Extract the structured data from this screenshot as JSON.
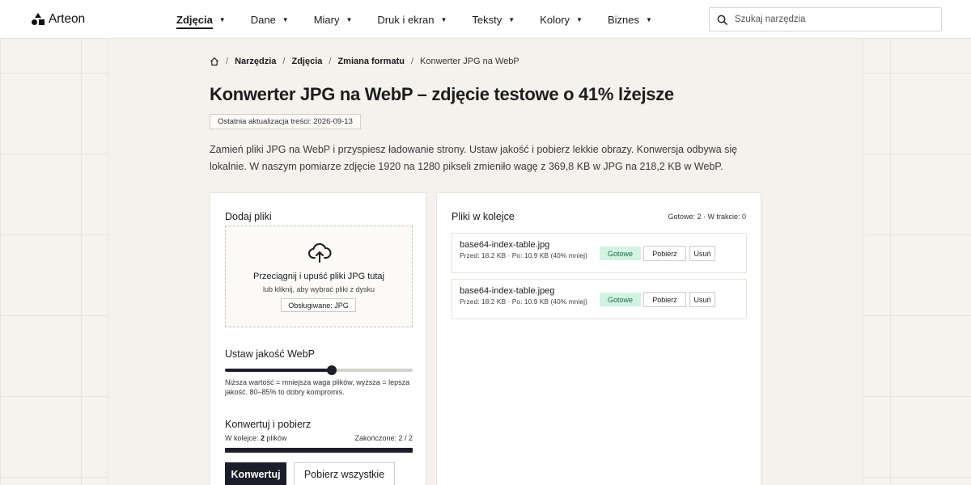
{
  "brand": {
    "name": "Arteon"
  },
  "nav": {
    "items": [
      {
        "label": "Zdjęcia",
        "active": true
      },
      {
        "label": "Dane",
        "active": false
      },
      {
        "label": "Miary",
        "active": false
      },
      {
        "label": "Druk i ekran",
        "active": false
      },
      {
        "label": "Teksty",
        "active": false
      },
      {
        "label": "Kolory",
        "active": false
      },
      {
        "label": "Biznes",
        "active": false
      }
    ]
  },
  "search": {
    "placeholder": "Szukaj narzędzia"
  },
  "breadcrumb": {
    "items": [
      "Narzędzia",
      "Zdjęcia",
      "Zmiana formatu"
    ],
    "current": "Konwerter JPG na WebP"
  },
  "page": {
    "title": "Konwerter JPG na WebP – zdjęcie testowe o 41% lżejsze",
    "updated": "Ostatnia aktualizacja treści: 2026-09-13",
    "intro": "Zamień pliki JPG na WebP i przyspiesz ładowanie strony. Ustaw jakość i pobierz lekkie obrazy. Konwersja odbywa się lokalnie. W naszym pomiarze zdjęcie 1920 na 1280 pikseli zmieniło wagę z 369,8 KB w JPG na 218,2 KB w WebP."
  },
  "upload": {
    "heading": "Dodaj pliki",
    "drop_title": "Przeciągnij i upuść pliki JPG tutaj",
    "drop_sub": "lub kliknij, aby wybrać pliki z dysku",
    "supported": "Obsługiwane: JPG"
  },
  "quality": {
    "heading": "Ustaw jakość WebP",
    "level": 0.57,
    "hint": "Niższa wartość = mniejsza waga plików, wyższa = lepsza jakość. 80–85% to dobry kompromis."
  },
  "convert": {
    "heading": "Konwertuj i pobierz",
    "queue_prefix": "W kolejce: ",
    "queue_count": "2",
    "queue_suffix": " plików",
    "done": "Zakończone: 2 / 2",
    "progress": 1.0,
    "convert_label": "Konwertuj",
    "download_all_label": "Pobierz wszystkie"
  },
  "queue": {
    "heading": "Pliki w kolejce",
    "status": "Gotowe: 2 · W trakcie: 0",
    "files": [
      {
        "name": "base64-index-table.jpg",
        "meta": "Przed: 18.2 KB · Po: 10.9 KB (40% mniej)",
        "status": "Gotowe",
        "download_label": "Pobierz",
        "remove_label": "Usuń"
      },
      {
        "name": "base64-index-table.jpeg",
        "meta": "Przed: 18.2 KB · Po: 10.9 KB (40% mniej)",
        "status": "Gotowe",
        "download_label": "Pobierz",
        "remove_label": "Usuń"
      }
    ]
  },
  "colors": {
    "accent": "#1c1c2a",
    "status_ok_bg": "#d2f3e2",
    "status_ok_text": "#1a6b45"
  }
}
